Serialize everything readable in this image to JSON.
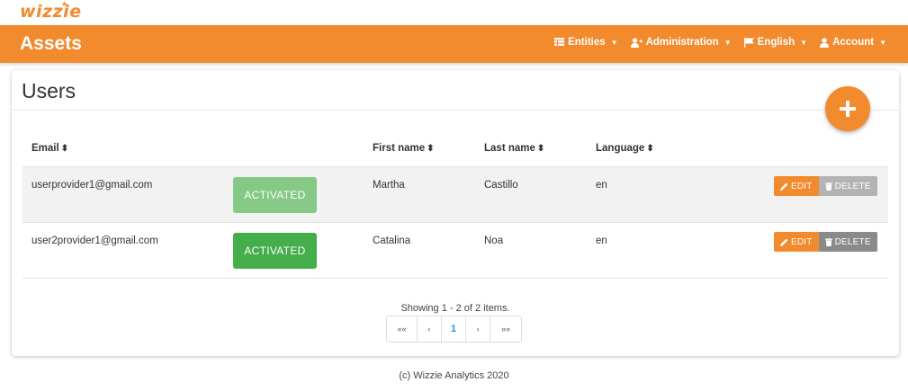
{
  "logo": {
    "text": "wizzie"
  },
  "navbar": {
    "brand": "Assets",
    "items": [
      {
        "label": "Entities",
        "icon": "table-icon"
      },
      {
        "label": "Administration",
        "icon": "user-plus-icon"
      },
      {
        "label": "English",
        "icon": "flag-icon"
      },
      {
        "label": "Account",
        "icon": "user-icon"
      }
    ]
  },
  "page": {
    "title": "Users",
    "add_button": "+"
  },
  "table": {
    "headers": {
      "email": "Email",
      "first_name": "First name",
      "last_name": "Last name",
      "language": "Language"
    },
    "rows": [
      {
        "email": "userprovider1@gmail.com",
        "status": "ACTIVATED",
        "first_name": "Martha",
        "last_name": "Castillo",
        "language": "en"
      },
      {
        "email": "user2provider1@gmail.com",
        "status": "ACTIVATED",
        "first_name": "Catalina",
        "last_name": "Noa",
        "language": "en"
      }
    ],
    "edit_label": "EDIT",
    "delete_label": "DELETE"
  },
  "pagination": {
    "summary": "Showing 1 - 2 of 2 items.",
    "first": "««",
    "prev": "‹",
    "current": "1",
    "next": "›",
    "last": "»»"
  },
  "footer": {
    "text": "(c) Wizzie Analytics 2020"
  },
  "colors": {
    "brand_orange": "#f28a2e",
    "activated_green": "#46ad4b",
    "activated_green_light": "#86c987",
    "page_link_blue": "#2a8de0"
  }
}
